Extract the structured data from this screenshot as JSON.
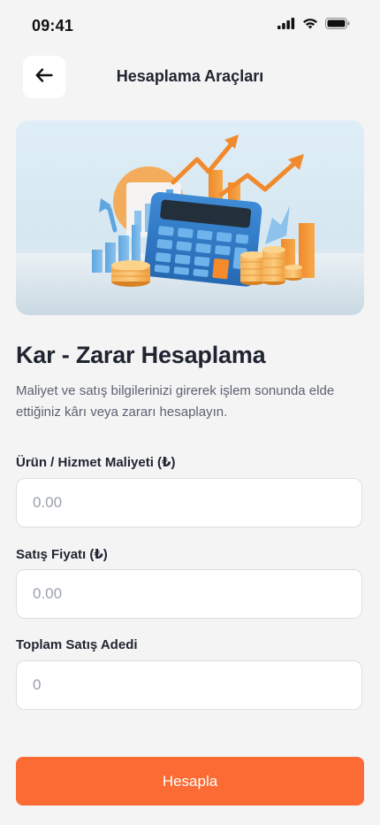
{
  "status_bar": {
    "time": "09:41",
    "icons": [
      "cellular-signal-icon",
      "wifi-icon",
      "battery-icon"
    ]
  },
  "header": {
    "back_icon": "arrow-left-icon",
    "title": "Hesaplama Araçları"
  },
  "hero": {
    "illustration": "calculator-coins-growth-chart-illustration"
  },
  "main": {
    "title": "Kar - Zarar Hesaplama",
    "description": "Maliyet ve satış bilgilerinizi girerek işlem sonunda elde ettiğiniz kârı veya zararı hesaplayın."
  },
  "form": {
    "cost": {
      "label": "Ürün / Hizmet Maliyeti (₺)",
      "placeholder": "0.00",
      "value": ""
    },
    "price": {
      "label": "Satış Fiyatı (₺)",
      "placeholder": "0.00",
      "value": ""
    },
    "quantity": {
      "label": "Toplam Satış Adedi",
      "placeholder": "0",
      "value": ""
    },
    "submit_label": "Hesapla"
  },
  "colors": {
    "accent": "#fb6b33",
    "background": "#f4f4f5",
    "text_primary": "#1f2430",
    "text_secondary": "#5c6270"
  }
}
